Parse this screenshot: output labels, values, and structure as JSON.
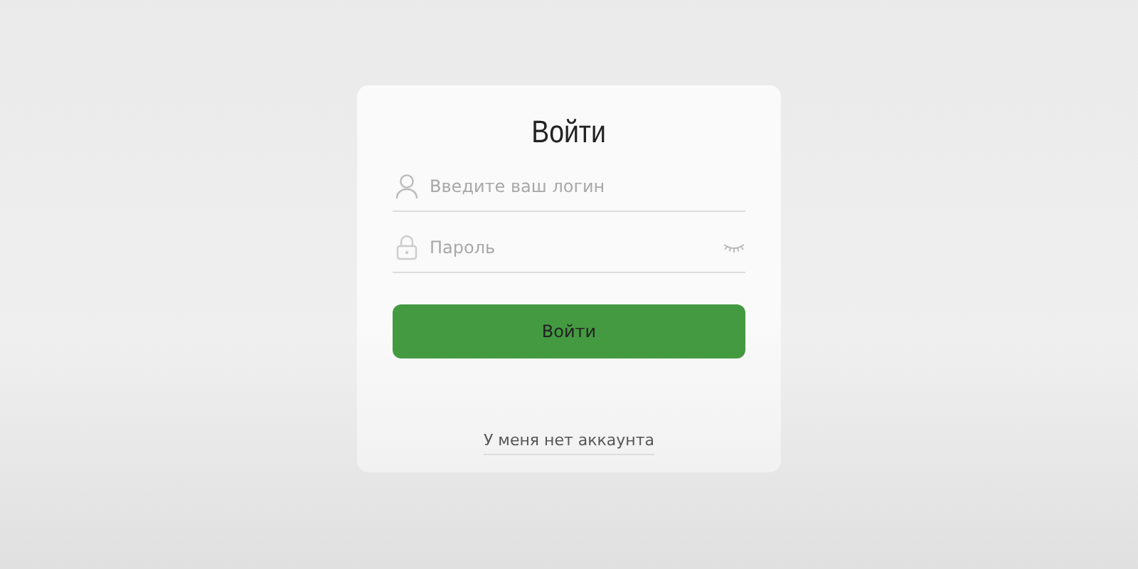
{
  "title": "Войти",
  "fields": [
    {
      "kind": "login",
      "placeholder": "Введите ваш логин"
    },
    {
      "kind": "password",
      "placeholder": "Пароль"
    }
  ],
  "submit": "Войти",
  "link": "У меня нет аккаунта"
}
